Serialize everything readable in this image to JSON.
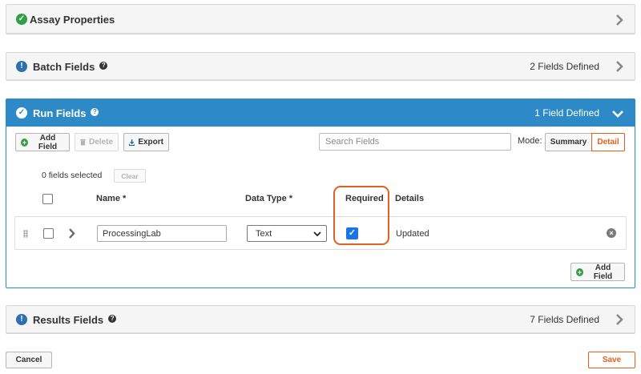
{
  "panels": {
    "assay": {
      "title": "Assay Properties",
      "status_color": "#2e9e47"
    },
    "batch": {
      "title": "Batch Fields",
      "count": "2 Fields Defined",
      "status_color": "#2e6fb0"
    },
    "run": {
      "title": "Run Fields",
      "count": "1 Field Defined"
    },
    "results": {
      "title": "Results Fields",
      "count": "7 Fields Defined",
      "status_color": "#2e6fb0"
    }
  },
  "run": {
    "toolbar": {
      "add_field": "Add Field",
      "delete": "Delete",
      "export": "Export"
    },
    "search": {
      "placeholder": "Search Fields",
      "value": ""
    },
    "mode": {
      "label": "Mode:",
      "summary": "Summary",
      "detail": "Detail",
      "selected": "Detail"
    },
    "selection": {
      "text": "0 fields selected",
      "clear": "Clear"
    },
    "columns": {
      "name": "Name *",
      "data_type": "Data Type *",
      "required": "Required",
      "details": "Details"
    },
    "rows": [
      {
        "name": "ProcessingLab",
        "data_type": "Text",
        "required": true,
        "details": "Updated"
      }
    ],
    "data_type_options": [
      "Text"
    ],
    "add_field_bottom": "Add Field",
    "highlight_color": "#e0601e"
  },
  "footer": {
    "cancel": "Cancel",
    "save": "Save",
    "save_color": "#e0601e"
  }
}
